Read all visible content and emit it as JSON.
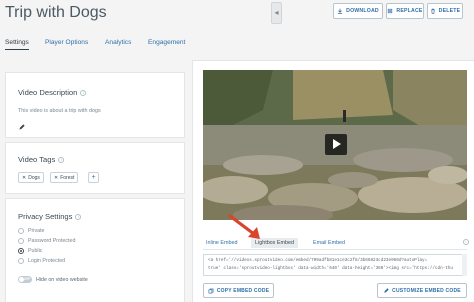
{
  "header": {
    "title": "Trip with Dogs",
    "collapse_glyph": "◂",
    "buttons": [
      {
        "label": "DOWNLOAD",
        "icon": "download-icon"
      },
      {
        "label": "REPLACE",
        "icon": "replace-icon"
      },
      {
        "label": "DELETE",
        "icon": "trash-icon"
      }
    ]
  },
  "tabs": [
    "Settings",
    "Player Options",
    "Analytics",
    "Engagement"
  ],
  "description": {
    "title": "Video Description",
    "text": "This video is about a trip with dogs"
  },
  "tags": {
    "title": "Video Tags",
    "items": [
      "Dogs",
      "Forest"
    ],
    "add_label": "+"
  },
  "privacy": {
    "title": "Privacy Settings",
    "options": [
      "Private",
      "Password Protected",
      "Public",
      "Login Protected"
    ],
    "selected": "Public",
    "toggle_label": "OFF",
    "hide_label": "Hide on video website"
  },
  "embed": {
    "tabs": [
      "Inline Embed",
      "Lightbox Embed",
      "Email Embed"
    ],
    "active_tab": "Lightbox Embed",
    "code_line1": "<a href='//videos.sproutvideo.com/embed/709adfb81e1ce3c2f8/3b66823cd23e960d?autoPlay=",
    "code_line2": "true' class='sproutvideo-lightbox' data-width='640' data-height='360'><img src='https://cdn-thu",
    "copy_label": "COPY EMBED CODE",
    "customize_label": "CUSTOMIZE EMBED CODE"
  },
  "colors": {
    "accent": "#2f6fa8",
    "arrow": "#d9442b"
  }
}
